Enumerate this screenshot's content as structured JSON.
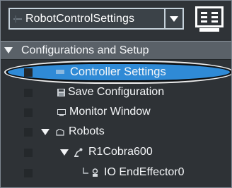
{
  "toolbar": {
    "workspace_select_value": "RobotControlSettings",
    "lead_icon": "grid-icon",
    "dropdown_icon": "caret-down-icon",
    "tool_icon": "controller-device-icon"
  },
  "tree": {
    "root": {
      "label": "Configurations and Setup",
      "icon": "expand-arrow-icon"
    },
    "items": [
      {
        "label": "Controller Settings",
        "icon": "controller-settings-icon",
        "selected": true
      },
      {
        "label": "Save Configuration",
        "icon": "save-icon"
      },
      {
        "label": "Monitor Window",
        "icon": "monitor-icon"
      },
      {
        "label": "Robots",
        "icon": "folder-icon"
      },
      {
        "label": "R1Cobra600",
        "icon": "robot-arm-icon"
      },
      {
        "label": "IO EndEffector0",
        "icon": "end-effector-icon"
      }
    ]
  },
  "colors": {
    "background": "#2e3236",
    "header": "#5a6168",
    "selection": "#2f8ad6",
    "text": "#f4f6f8"
  }
}
